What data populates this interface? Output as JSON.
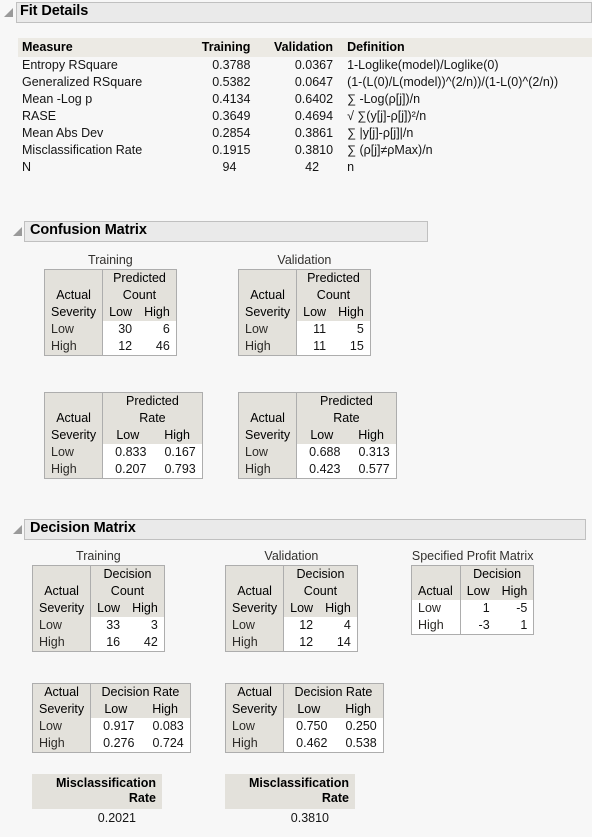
{
  "sections": {
    "fit_details": {
      "title": "Fit Details"
    },
    "confusion_matrix": {
      "title": "Confusion Matrix"
    },
    "decision_matrix": {
      "title": "Decision Matrix"
    }
  },
  "fit_details": {
    "columns": [
      "Measure",
      "Training",
      "Validation",
      "Definition"
    ],
    "rows": [
      {
        "measure": "Entropy RSquare",
        "training": "0.3788",
        "validation": "0.0367",
        "definition": "1-Loglike(model)/Loglike(0)"
      },
      {
        "measure": "Generalized RSquare",
        "training": "0.5382",
        "validation": "0.0647",
        "definition": "(1-(L(0)/L(model))^(2/n))/(1-L(0)^(2/n))"
      },
      {
        "measure": "Mean -Log p",
        "training": "0.4134",
        "validation": "0.6402",
        "definition": "∑ -Log(ρ[j])/n"
      },
      {
        "measure": "RASE",
        "training": "0.3649",
        "validation": "0.4694",
        "definition": "√ ∑(y[j]-ρ[j])²/n"
      },
      {
        "measure": "Mean Abs Dev",
        "training": "0.2854",
        "validation": "0.3861",
        "definition": "∑ |y[j]-ρ[j]|/n"
      },
      {
        "measure": "Misclassification Rate",
        "training": "0.1915",
        "validation": "0.3810",
        "definition": "∑ (ρ[j]≠ρMax)/n"
      },
      {
        "measure": "N",
        "training": "94",
        "validation": "42",
        "definition": "n"
      }
    ]
  },
  "confusion": {
    "captions": {
      "training": "Training",
      "validation": "Validation"
    },
    "labels": {
      "actual": "Actual",
      "severity": "Severity",
      "predicted": "Predicted",
      "count": "Count",
      "rate": "Rate",
      "low": "Low",
      "high": "High"
    },
    "training_count": {
      "low_row": [
        "30",
        "6"
      ],
      "high_row": [
        "12",
        "46"
      ]
    },
    "validation_count": {
      "low_row": [
        "11",
        "5"
      ],
      "high_row": [
        "11",
        "15"
      ]
    },
    "training_rate": {
      "low_row": [
        "0.833",
        "0.167"
      ],
      "high_row": [
        "0.207",
        "0.793"
      ]
    },
    "validation_rate": {
      "low_row": [
        "0.688",
        "0.313"
      ],
      "high_row": [
        "0.423",
        "0.577"
      ]
    }
  },
  "decision": {
    "captions": {
      "training": "Training",
      "validation": "Validation",
      "profit": "Specified Profit Matrix"
    },
    "labels": {
      "actual": "Actual",
      "severity": "Severity",
      "decision": "Decision",
      "count": "Count",
      "decision_rate": "Decision Rate",
      "low": "Low",
      "high": "High",
      "misclassification": "Misclassification",
      "rate": "Rate"
    },
    "training_count": {
      "low_row": [
        "33",
        "3"
      ],
      "high_row": [
        "16",
        "42"
      ]
    },
    "validation_count": {
      "low_row": [
        "12",
        "4"
      ],
      "high_row": [
        "12",
        "14"
      ]
    },
    "training_rate": {
      "low_row": [
        "0.917",
        "0.083"
      ],
      "high_row": [
        "0.276",
        "0.724"
      ]
    },
    "validation_rate": {
      "low_row": [
        "0.750",
        "0.250"
      ],
      "high_row": [
        "0.462",
        "0.538"
      ]
    },
    "profit_matrix": {
      "low_row": [
        "1",
        "-5"
      ],
      "high_row": [
        "-3",
        "1"
      ]
    },
    "training_misclassification": "0.2021",
    "validation_misclassification": "0.3810"
  }
}
